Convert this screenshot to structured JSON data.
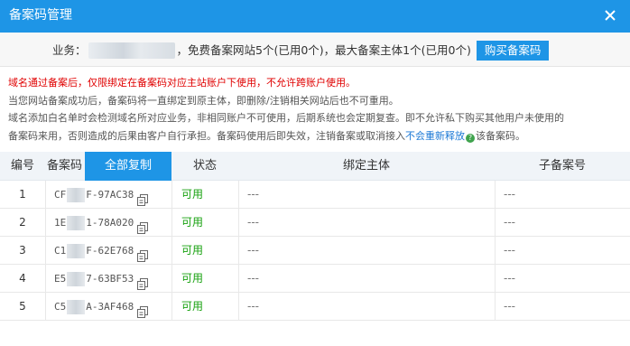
{
  "dialog": {
    "title": "备案码管理",
    "close_icon": "close-icon"
  },
  "infobar": {
    "prefix": "业务：",
    "text": "，免费备案网站5个(已用0个)，最大备案主体1个(已用0个)",
    "buy_button": "购买备案码"
  },
  "notes": {
    "warning": "域名通过备案后，仅限绑定在备案码对应主站账户下使用，不允许跨账户使用。",
    "line2": "当您网站备案成功后，备案码将一直绑定到原主体，即删除/注销相关网站后也不可重用。",
    "line3": "域名添加白名单时会检测域名所对应业务，非相同账户不可使用，后期系统也会定期复查。即不允许私下购买其他用户未使用的",
    "line4_pre": "备案码来用，否则造成的后果由客户自行承担。备案码使用后即失效，注销备案或取消接入",
    "line4_link": "不会重新释放",
    "line4_post": "该备案码。"
  },
  "table": {
    "headers": {
      "index": "编号",
      "code": "备案码",
      "copy_all": "全部复制",
      "status": "状态",
      "bound": "绑定主体",
      "sub": "子备案号"
    },
    "rows": [
      {
        "index": "1",
        "code_start": "CF",
        "code_end": "F-97AC38",
        "status": "可用",
        "bound": "---",
        "sub": "---"
      },
      {
        "index": "2",
        "code_start": "1E",
        "code_end": "1-78A020",
        "status": "可用",
        "bound": "---",
        "sub": "---"
      },
      {
        "index": "3",
        "code_start": "C1",
        "code_end": "F-62E768",
        "status": "可用",
        "bound": "---",
        "sub": "---"
      },
      {
        "index": "4",
        "code_start": "E5",
        "code_end": "7-63BF53",
        "status": "可用",
        "bound": "---",
        "sub": "---"
      },
      {
        "index": "5",
        "code_start": "C5",
        "code_end": "A-3AF468",
        "status": "可用",
        "bound": "---",
        "sub": "---"
      }
    ]
  },
  "colors": {
    "accent": "#1e95e6",
    "warning": "#e00000",
    "status_ok": "#17a10f",
    "link": "#1e7ad6"
  }
}
